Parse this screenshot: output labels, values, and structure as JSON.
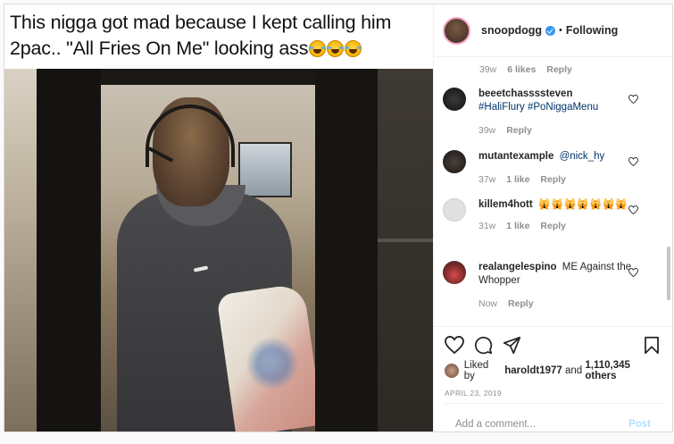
{
  "media": {
    "caption_line1": "This nigga got mad because I kept calling him",
    "caption_line2": "2pac.. \"All Fries On Me\" looking ass"
  },
  "header": {
    "username": "snoopdogg",
    "separator": "•",
    "follow_status": "Following"
  },
  "top_meta": {
    "time": "39w",
    "likes": "6 likes",
    "reply": "Reply"
  },
  "comments": [
    {
      "user": "beeetchassssteven",
      "text": "#HaliFlury #PoNiggaMenu",
      "time": "39w",
      "likes": "",
      "reply": "Reply"
    },
    {
      "user": "mutantexample",
      "text": "@nick_hy",
      "time": "37w",
      "likes": "1 like",
      "reply": "Reply"
    },
    {
      "user": "killem4hott",
      "text": "🙀🙀🙀🙀🙀🙀🙀",
      "time": "31w",
      "likes": "1 like",
      "reply": "Reply"
    },
    {
      "user": "realangelespino",
      "text": "ME Against the Whopper",
      "time": "Now",
      "likes": "",
      "reply": "Reply"
    }
  ],
  "likes": {
    "prefix": "Liked by",
    "user": "haroldt1977",
    "middle": "and",
    "count": "1,110,345 others"
  },
  "date": "APRIL 23, 2019",
  "add_comment": {
    "placeholder": "Add a comment...",
    "post_label": "Post"
  },
  "icons": [
    "heart-icon",
    "comment-icon",
    "share-icon",
    "bookmark-icon",
    "verified-badge-icon"
  ]
}
